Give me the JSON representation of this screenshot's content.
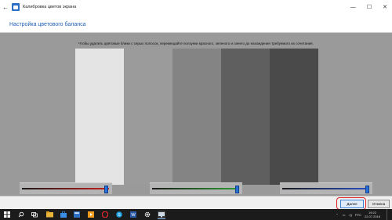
{
  "window": {
    "title": "Калибровка цветов экрана",
    "back_glyph": "←",
    "controls": [
      "—",
      "☐",
      "✕"
    ]
  },
  "page": {
    "title": "Настройка цветового баланса",
    "instruction": "Чтобы удалить цветовые блики с серых полосок, перемещайте ползунки красного, зеленого и синего до нахождения требуемого их сочетания."
  },
  "gray_bars": [
    "#e4e4e4",
    "#9b9b9b",
    "#848484",
    "#5f5f5f",
    "#4a4a4a"
  ],
  "sliders": [
    {
      "name": "red",
      "color": "#c41e1e",
      "value_pct": 96
    },
    {
      "name": "green",
      "color": "#2e9e35",
      "value_pct": 97
    },
    {
      "name": "blue",
      "color": "#2a4fc4",
      "value_pct": 97
    }
  ],
  "buttons": {
    "next": "Далее",
    "cancel": "Отмена"
  },
  "taskbar": {
    "language": "РУС",
    "time": "19:22",
    "date": "22.07.2016"
  }
}
